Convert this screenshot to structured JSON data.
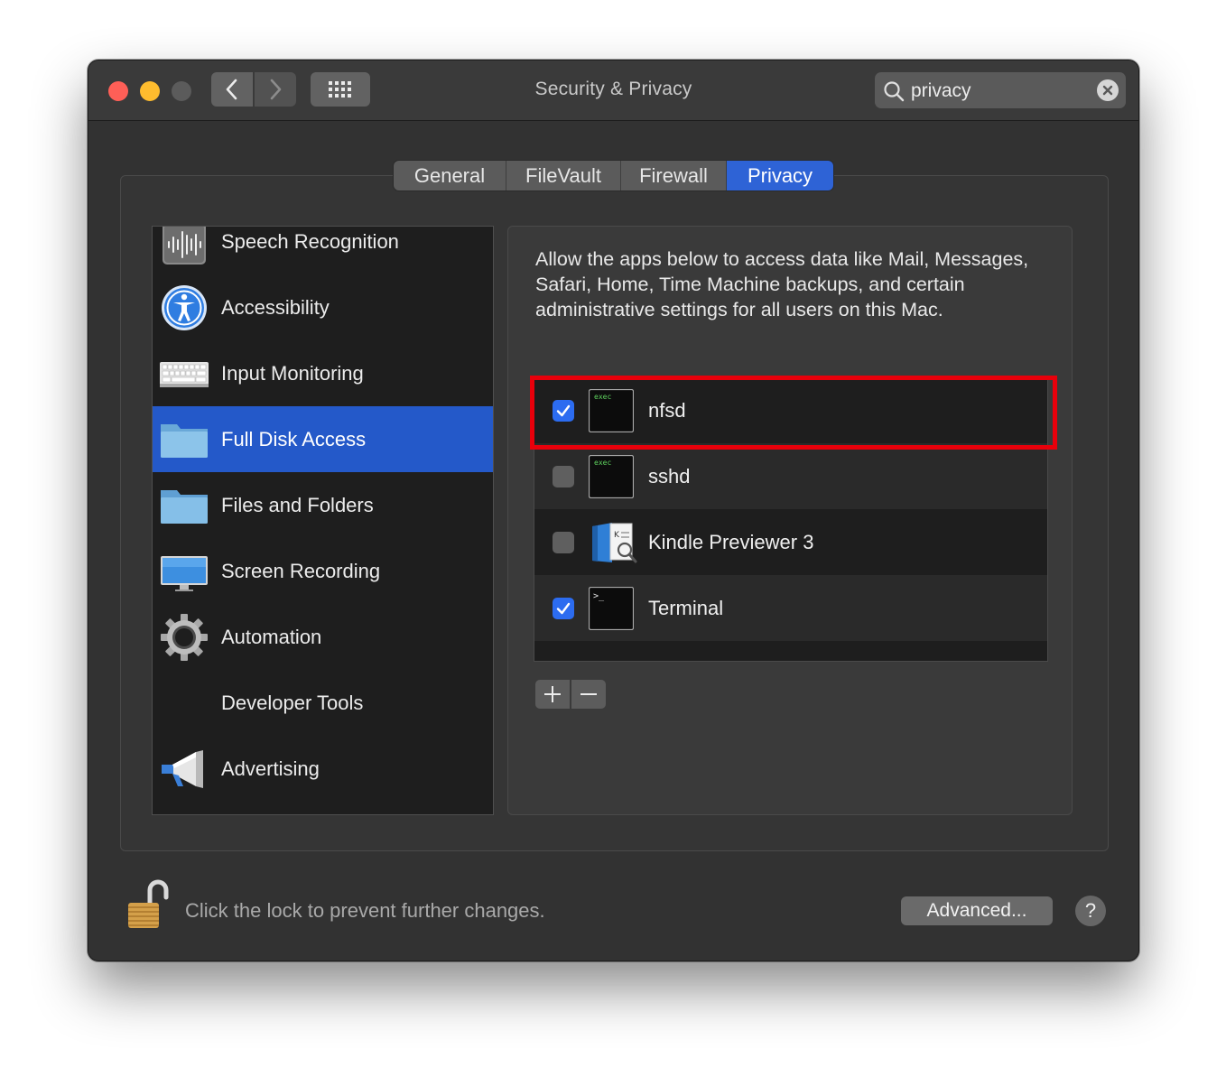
{
  "window": {
    "title": "Security & Privacy"
  },
  "search": {
    "value": "privacy"
  },
  "tabs": [
    {
      "label": "General",
      "active": false
    },
    {
      "label": "FileVault",
      "active": false
    },
    {
      "label": "Firewall",
      "active": false
    },
    {
      "label": "Privacy",
      "active": true
    }
  ],
  "sidebar": {
    "items": [
      {
        "label": "Speech Recognition",
        "icon": "waveform-icon",
        "selected": false
      },
      {
        "label": "Accessibility",
        "icon": "accessibility-icon",
        "selected": false
      },
      {
        "label": "Input Monitoring",
        "icon": "keyboard-icon",
        "selected": false
      },
      {
        "label": "Full Disk Access",
        "icon": "folder-icon",
        "selected": true
      },
      {
        "label": "Files and Folders",
        "icon": "folder-icon",
        "selected": false
      },
      {
        "label": "Screen Recording",
        "icon": "display-icon",
        "selected": false
      },
      {
        "label": "Automation",
        "icon": "gear-icon",
        "selected": false
      },
      {
        "label": "Developer Tools",
        "icon": "",
        "selected": false
      },
      {
        "label": "Advertising",
        "icon": "megaphone-icon",
        "selected": false
      }
    ]
  },
  "panel": {
    "description": "Allow the apps below to access data like Mail, Messages, Safari, Home, Time Machine backups, and certain administrative settings for all users on this Mac.",
    "apps": [
      {
        "name": "nfsd",
        "checked": true,
        "icon": "exec-icon",
        "icon_text": "exec"
      },
      {
        "name": "sshd",
        "checked": false,
        "icon": "exec-icon",
        "icon_text": "exec"
      },
      {
        "name": "Kindle Previewer 3",
        "checked": false,
        "icon": "kindle-previewer-icon"
      },
      {
        "name": "Terminal",
        "checked": true,
        "icon": "terminal-icon",
        "icon_text": ">_"
      }
    ],
    "add_label": "+",
    "remove_label": "—"
  },
  "footer": {
    "lock_text": "Click the lock to prevent further changes.",
    "advanced_label": "Advanced...",
    "help_label": "?"
  },
  "colors": {
    "accent": "#2459c9",
    "highlight_box": "#e8000b",
    "checkbox_on": "#2c6cf0"
  }
}
